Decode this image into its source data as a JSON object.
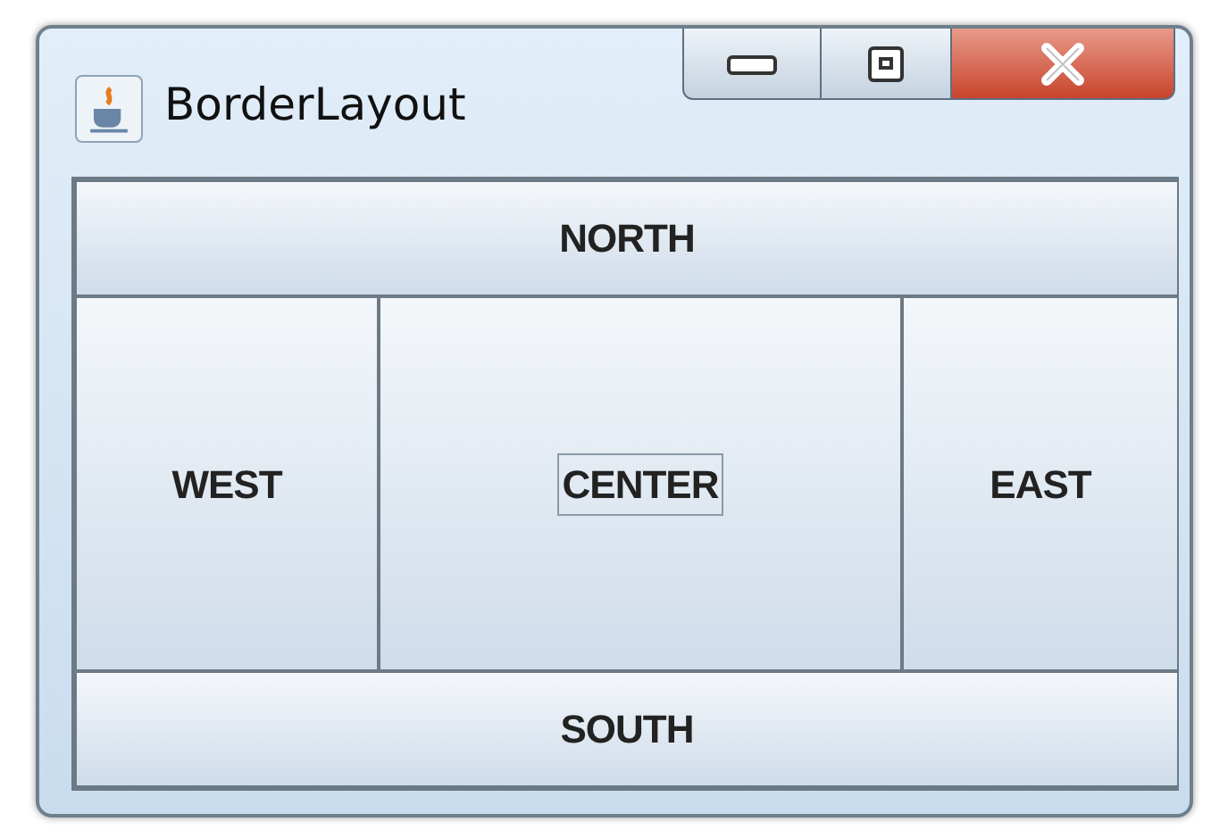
{
  "window": {
    "title": "BorderLayout"
  },
  "buttons": [
    {
      "label": "NORTH",
      "kind": "north",
      "focused": false
    },
    {
      "label": "WEST",
      "kind": "west",
      "focused": false
    },
    {
      "label": "CENTER",
      "kind": "center",
      "focused": true
    },
    {
      "label": "EAST",
      "kind": "east",
      "focused": false
    },
    {
      "label": "SOUTH",
      "kind": "south",
      "focused": false
    }
  ]
}
